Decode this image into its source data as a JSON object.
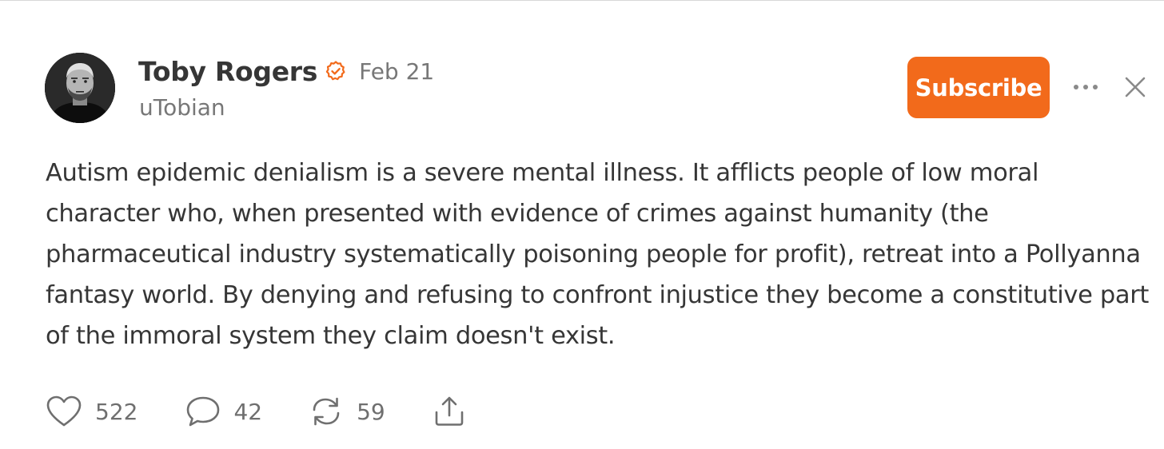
{
  "post": {
    "author": {
      "name": "Toby Rogers",
      "handle": "uTobian",
      "verified": true,
      "verified_icon": "verified-check-icon"
    },
    "date": "Feb 21",
    "body": "Autism epidemic denialism is a severe mental illness. It afflicts people of low moral character who, when presented with evidence of crimes against humanity (the pharmaceutical industry systematically poisoning people for profit), retreat into a Pollyanna fantasy world. By denying and refusing to confront injustice they become a constitutive part of the immoral system they claim doesn't exist."
  },
  "header_actions": {
    "subscribe_label": "Subscribe",
    "more_icon": "more-horizontal-icon",
    "close_icon": "close-icon"
  },
  "stats": {
    "likes": "522",
    "comments": "42",
    "restacks": "59"
  },
  "icons": {
    "like": "heart-icon",
    "comment": "comment-bubble-icon",
    "restack": "restack-icon",
    "share": "share-icon"
  },
  "colors": {
    "accent": "#f26a1b",
    "text": "#363636",
    "muted": "#777777"
  }
}
